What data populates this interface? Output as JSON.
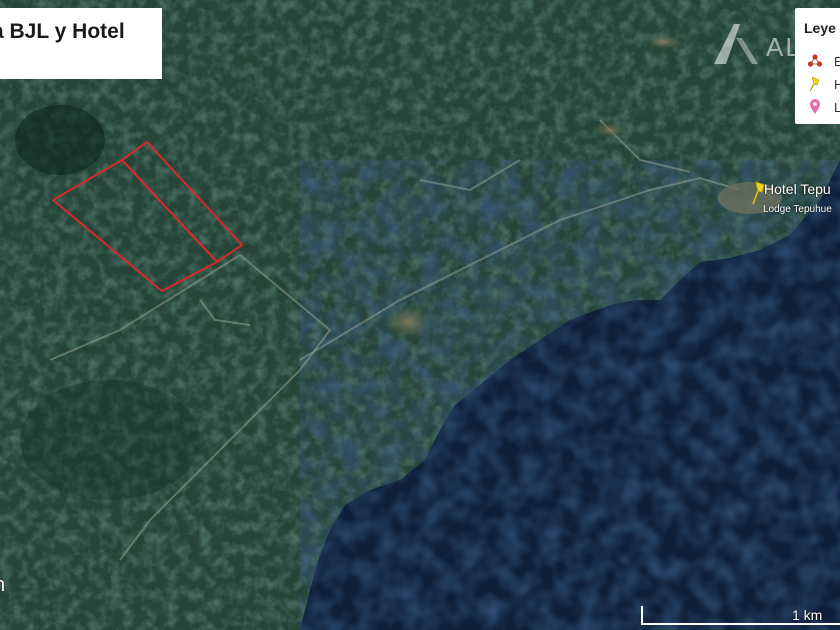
{
  "map": {
    "title": "a BJL y Hotel",
    "legend": {
      "title": "Leye",
      "items": [
        {
          "label": "E",
          "icon": "polygon-vertices-icon",
          "color": "#c0392b"
        },
        {
          "label": "H",
          "icon": "yellow-pushpin-icon",
          "color": "#f2d21b"
        },
        {
          "label": "L",
          "icon": "pink-pin-icon",
          "color": "#e56fa8"
        }
      ]
    },
    "watermark": "AL",
    "placemarks": {
      "hotel": {
        "label": "Hotel Tepu",
        "icon": "yellow-pushpin-icon"
      },
      "lodge": {
        "label": "Lodge Tepuhue"
      }
    },
    "polygon_color": "#d62a2a",
    "attribution": "h",
    "scale_bar": "1 km"
  }
}
